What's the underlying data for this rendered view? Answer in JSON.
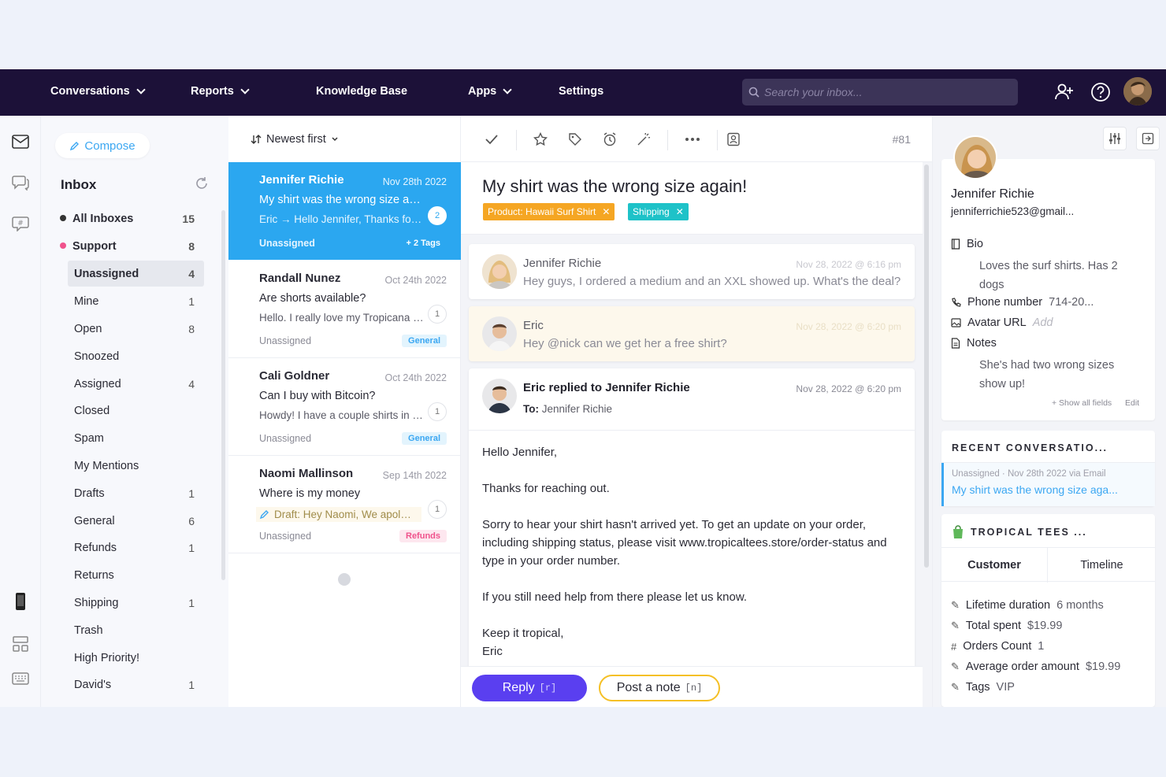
{
  "nav": {
    "conversations": "Conversations",
    "reports": "Reports",
    "knowledge_base": "Knowledge Base",
    "apps": "Apps",
    "settings": "Settings",
    "search_placeholder": "Search your inbox..."
  },
  "sidebar": {
    "compose": "Compose",
    "inbox_title": "Inbox",
    "top_items": [
      {
        "label": "All Inboxes",
        "count": "15",
        "dot": "#333333"
      },
      {
        "label": "Support",
        "count": "8",
        "dot": "#f0528c"
      }
    ],
    "folders": [
      {
        "label": "Unassigned",
        "count": "4"
      },
      {
        "label": "Mine",
        "count": "1"
      },
      {
        "label": "Open",
        "count": "8"
      },
      {
        "label": "Snoozed",
        "count": ""
      },
      {
        "label": "Assigned",
        "count": "4"
      },
      {
        "label": "Closed",
        "count": ""
      },
      {
        "label": "Spam",
        "count": ""
      },
      {
        "label": "My Mentions",
        "count": ""
      },
      {
        "label": "Drafts",
        "count": "1"
      },
      {
        "label": "General",
        "count": "6"
      },
      {
        "label": "Refunds",
        "count": "1"
      },
      {
        "label": "Returns",
        "count": ""
      },
      {
        "label": "Shipping",
        "count": "1"
      },
      {
        "label": "Trash",
        "count": ""
      },
      {
        "label": "High Priority!",
        "count": ""
      },
      {
        "label": "David's",
        "count": "1"
      }
    ]
  },
  "list": {
    "sort": "Newest first",
    "conversations": [
      {
        "name": "Jennifer Richie",
        "date": "Nov 28th 2022",
        "subject": "My shirt was the wrong size again!",
        "preview": "Eric → Hello Jennifer,  Thanks for reaching out.",
        "status": "Unassigned",
        "tag": "+ 2 Tags",
        "badge": "2"
      },
      {
        "name": "Randall Nunez",
        "date": "Oct 24th 2022",
        "subject": "Are shorts available?",
        "preview": "Hello. I really love my Tropicana shirt",
        "status": "Unassigned",
        "tag": "General",
        "badge": "1"
      },
      {
        "name": "Cali Goldner",
        "date": "Oct 24th 2022",
        "subject": "Can I buy with Bitcoin?",
        "preview": "Howdy! I have a couple shirts in my cart",
        "status": "Unassigned",
        "tag": "General",
        "badge": "1"
      },
      {
        "name": "Naomi Mallinson",
        "date": "Sep 14th 2022",
        "subject": "Where is my money",
        "preview": "Draft: Hey Naomi, We apologize",
        "status": "Unassigned",
        "tag": "Refunds",
        "badge": "1"
      }
    ]
  },
  "main": {
    "conv_number": "#81",
    "subject": "My shirt was the wrong size again!",
    "tags": [
      {
        "label": "Product: Hawaii Surf Shirt",
        "color": "#f5a623"
      },
      {
        "label": "Shipping",
        "color": "#1ec2c8"
      }
    ],
    "messages": [
      {
        "who": "Jennifer Richie",
        "when": "Nov 28, 2022 @ 6:16 pm",
        "body": "Hey guys, I ordered a medium and an XXL showed up.  What's the deal?"
      },
      {
        "who": "Eric",
        "when": "Nov 28, 2022 @ 6:20 pm",
        "body": "Hey @nick can we get her a free shirt?"
      }
    ],
    "reply": {
      "who": "Eric replied to Jennifer Richie",
      "when": "Nov 28, 2022 @ 6:20 pm",
      "to_label": "To:",
      "to": "Jennifer Richie",
      "paragraphs": [
        "Hello Jennifer,",
        "Thanks for reaching out.",
        "Sorry to hear your shirt hasn't arrived yet.  To get an update on your order, including shipping status, please visit www.tropicaltees.store/order-status and type in your order number.",
        "If you still need help from there please let us know.",
        "Keep it tropical,\nEric"
      ]
    },
    "reply_button": "Reply",
    "reply_key": "[r]",
    "note_button": "Post a note",
    "note_key": "[n]"
  },
  "right": {
    "name": "Jennifer Richie",
    "email": "jenniferrichie523@gmail...",
    "bio_label": "Bio",
    "bio": "Loves the surf shirts. Has 2 dogs",
    "phone_label": "Phone number",
    "phone": "714-20...",
    "avatar_label": "Avatar URL",
    "avatar_value": "Add",
    "notes_label": "Notes",
    "notes": "She's had two wrong sizes show up!",
    "show_all": "+ Show all fields",
    "edit": "Edit",
    "recent_title": "RECENT CONVERSATIO...",
    "recent_meta": "Unassigned · Nov 28th 2022 via Email",
    "recent_subject": "My shirt was the wrong size aga...",
    "app_title": "TROPICAL TEES ...",
    "tab_customer": "Customer",
    "tab_timeline": "Timeline",
    "stats": [
      {
        "label": "Lifetime duration",
        "value": "6 months",
        "icon": "pencil"
      },
      {
        "label": "Total spent",
        "value": "$19.99",
        "icon": "pencil"
      },
      {
        "label": "Orders Count",
        "value": "1",
        "icon": "hash"
      },
      {
        "label": "Average order amount",
        "value": "$19.99",
        "icon": "pencil"
      },
      {
        "label": "Tags",
        "value": "VIP",
        "icon": "pencil"
      }
    ]
  }
}
